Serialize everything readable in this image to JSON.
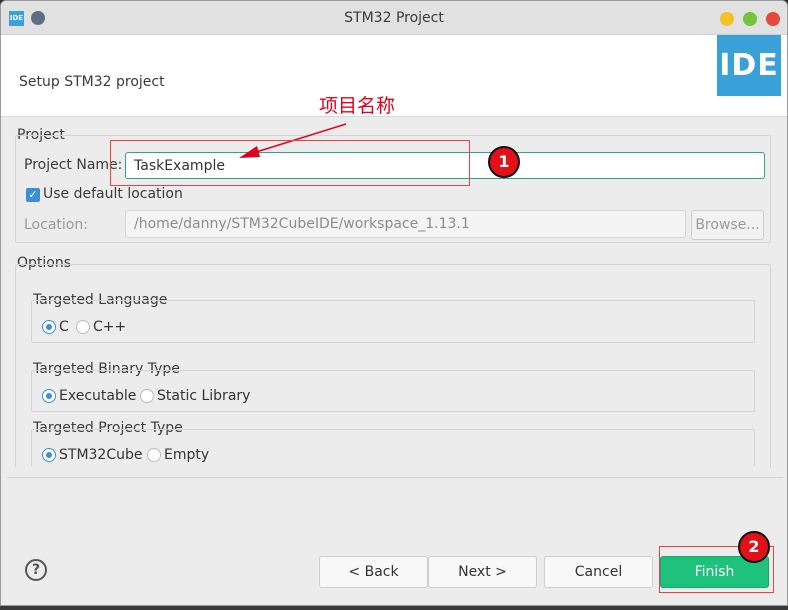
{
  "window": {
    "app_icon_text": "IDE",
    "title": "STM32 Project"
  },
  "header": {
    "setup_title": "Setup STM32 project",
    "logo_text": "IDE"
  },
  "annotations": {
    "label": "项目名称",
    "badge1": "1",
    "badge2": "2",
    "color": "#e0001b"
  },
  "project": {
    "group_label": "Project",
    "name_label": "Project Name:",
    "name_value": "TaskExample",
    "use_default_label": "Use default location",
    "use_default_checked": true,
    "location_label": "Location:",
    "location_value": "/home/danny/STM32CubeIDE/workspace_1.13.1",
    "browse_label": "Browse..."
  },
  "options": {
    "group_label": "Options",
    "language": {
      "label": "Targeted Language",
      "opt1": "C",
      "opt2": "C++",
      "selected": "C"
    },
    "binary_type": {
      "label": "Targeted Binary Type",
      "opt1": "Executable",
      "opt2": "Static Library",
      "selected": "Executable"
    },
    "project_type": {
      "label": "Targeted Project Type",
      "opt1": "STM32Cube",
      "opt2": "Empty",
      "selected": "STM32Cube"
    }
  },
  "buttons": {
    "help": "?",
    "back": "< Back",
    "next": "Next >",
    "cancel": "Cancel",
    "finish": "Finish"
  },
  "colors": {
    "accent": "#3aa0d8",
    "finish": "#1ec27c",
    "annotation": "#e54444"
  }
}
